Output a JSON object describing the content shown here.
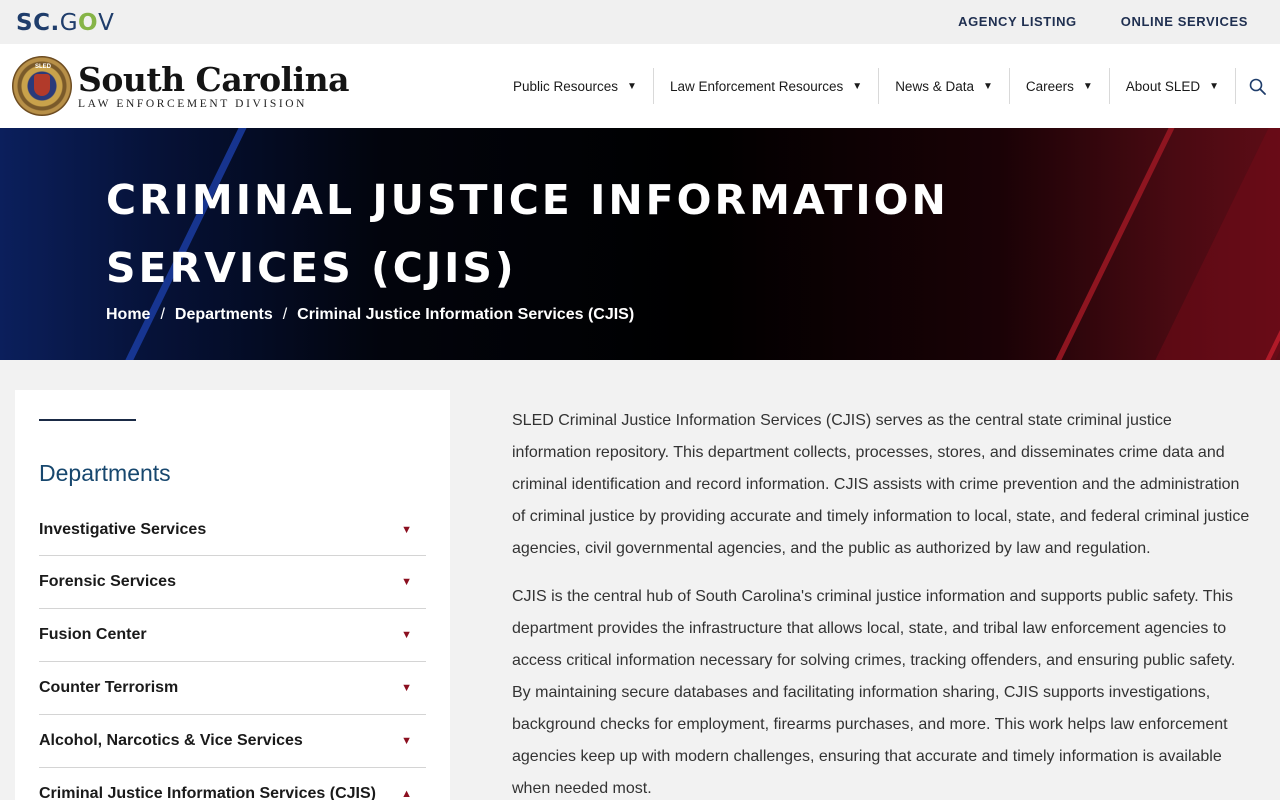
{
  "util": {
    "logo": {
      "sc": "SC",
      "dot": ".",
      "g": "G",
      "o": "O",
      "v": "V"
    },
    "links": [
      "AGENCY LISTING",
      "ONLINE SERVICES"
    ]
  },
  "header": {
    "seal_text": "SLED",
    "brand_name": "South Carolina",
    "brand_sub": "LAW ENFORCEMENT DIVISION",
    "nav": [
      {
        "label": "Public Resources"
      },
      {
        "label": "Law Enforcement Resources"
      },
      {
        "label": "News & Data"
      },
      {
        "label": "Careers"
      },
      {
        "label": "About SLED"
      }
    ],
    "caret": "▼"
  },
  "hero": {
    "title": "CRIMINAL JUSTICE INFORMATION SERVICES (CJIS)",
    "breadcrumb": {
      "home": "Home",
      "departments": "Departments",
      "current": "Criminal Justice Information Services (CJIS)",
      "sep": "/"
    }
  },
  "sidebar": {
    "title": "Departments",
    "items": [
      {
        "label": "Investigative Services",
        "icon": "▼"
      },
      {
        "label": "Forensic Services",
        "icon": "▼"
      },
      {
        "label": "Fusion Center",
        "icon": "▼"
      },
      {
        "label": "Counter Terrorism",
        "icon": "▼"
      },
      {
        "label": "Alcohol, Narcotics & Vice Services",
        "icon": "▼"
      },
      {
        "label": "Criminal Justice Information Services (CJIS)",
        "icon": "▲"
      }
    ]
  },
  "content": {
    "paragraphs": [
      "SLED Criminal Justice Information Services (CJIS) serves as the central state criminal justice information repository. This department collects, processes, stores, and disseminates crime data and criminal identification and record information. CJIS assists with crime prevention and the administration of criminal justice by providing accurate and timely information to local, state, and federal criminal justice agencies, civil governmental agencies, and the public as authorized by law and regulation.",
      "CJIS is the central hub of South Carolina's criminal justice information and supports public safety. This department provides the infrastructure that allows local, state, and tribal law enforcement agencies to access critical information necessary for solving crimes, tracking offenders, and ensuring public safety. By maintaining secure databases and facilitating information sharing, CJIS supports investigations, background checks for employment, firearms purchases, and more. This work helps law enforcement agencies keep up with modern challenges, ensuring that accurate and timely information is available when needed most."
    ]
  },
  "colors": {
    "navy": "#1f3d6b",
    "gov_green": "#86b447",
    "dept_blue": "#17476e",
    "accent_red": "#8b0f1f"
  }
}
